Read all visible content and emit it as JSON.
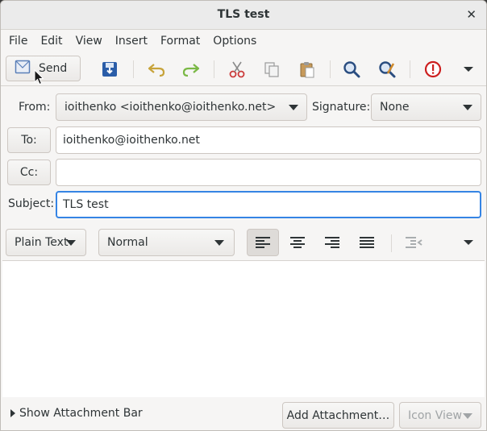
{
  "window": {
    "title": "TLS test"
  },
  "menu": [
    "File",
    "Edit",
    "View",
    "Insert",
    "Format",
    "Options"
  ],
  "toolbar": {
    "send_label": "Send"
  },
  "from": {
    "label": "From:",
    "value": "ioithenko <ioithenko@ioithenko.net>"
  },
  "signature": {
    "label": "Signature:",
    "value": "None"
  },
  "to": {
    "label": "To:",
    "value": "ioithenko@ioithenko.net"
  },
  "cc": {
    "label": "Cc:",
    "value": ""
  },
  "subject": {
    "label": "Subject:",
    "value": "TLS test"
  },
  "format": {
    "mode": "Plain Text",
    "paragraph": "Normal",
    "active_alignment": "left"
  },
  "bottom": {
    "attachment_bar_label": "Show Attachment Bar",
    "add_attachment_label": "Add Attachment…",
    "view_label": "Icon View"
  },
  "colors": {
    "focus": "#3584e4",
    "cut": "#cc3b3b",
    "undo": "#c7a33a",
    "redo": "#7ab845",
    "blue_icons": "#2a5da8",
    "priority": "#cc1f1f"
  }
}
